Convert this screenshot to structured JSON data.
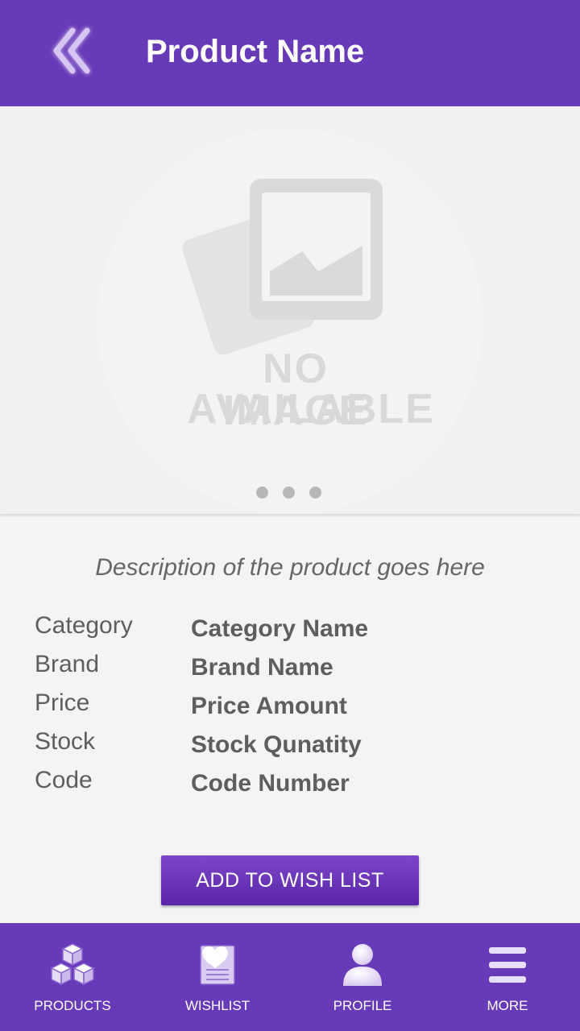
{
  "header": {
    "title": "Product Name",
    "back_icon": "double-chevron-left-icon"
  },
  "gallery": {
    "placeholder_line1": "NO IMAGE",
    "placeholder_line2": "AVAILABLE",
    "page_count": 3
  },
  "product": {
    "description": "Description of the product goes here",
    "specs": [
      {
        "label": "Category",
        "value": "Category Name"
      },
      {
        "label": "Brand",
        "value": "Brand Name"
      },
      {
        "label": "Price",
        "value": "Price Amount"
      },
      {
        "label": "Stock",
        "value": "Stock Qunatity"
      },
      {
        "label": "Code",
        "value": "Code Number"
      }
    ]
  },
  "actions": {
    "wishlist_button": "ADD TO WISH LIST"
  },
  "bottom_nav": {
    "items": [
      {
        "label": "PRODUCTS",
        "icon": "boxes-icon"
      },
      {
        "label": "WISHLIST",
        "icon": "wishlist-heart-icon"
      },
      {
        "label": "PROFILE",
        "icon": "person-icon"
      },
      {
        "label": "MORE",
        "icon": "menu-icon"
      }
    ]
  },
  "colors": {
    "primary": "#673ab7",
    "background": "#f4f4f4",
    "text": "#5e5e5e"
  }
}
